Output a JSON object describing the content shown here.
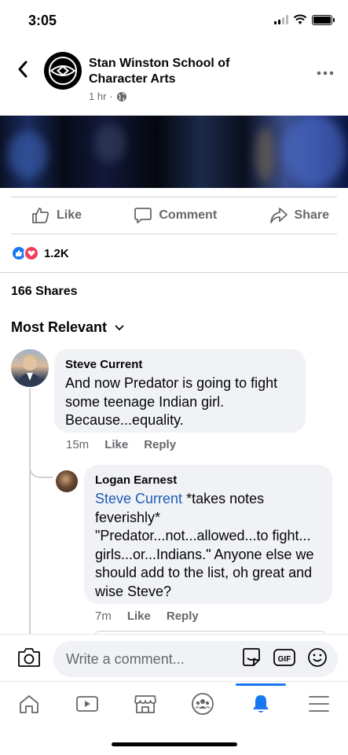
{
  "status_bar": {
    "time": "3:05",
    "icons": [
      "signal-icon",
      "wifi-icon",
      "battery-icon"
    ]
  },
  "header": {
    "page_name": "Stan Winston School of Character Arts",
    "time_ago": "1 hr",
    "separator": "·",
    "privacy_icon": "globe-icon"
  },
  "actions": {
    "like": "Like",
    "comment": "Comment",
    "share": "Share"
  },
  "reactions": {
    "count": "1.2K",
    "types": [
      "like",
      "love"
    ]
  },
  "shares": "166 Shares",
  "sort": {
    "label": "Most Relevant"
  },
  "comments": [
    {
      "author": "Steve Current",
      "text": "And now Predator is going to fight some teenage Indian girl. Because...equality.",
      "time": "15m",
      "like": "Like",
      "reply": "Reply"
    },
    {
      "author": "Logan Earnest",
      "mention": "Steve Current",
      "text": " *takes notes feverishly* \"Predator...not...allowed...to fight... girls...or...Indians.\" Anyone else we should add to the list, oh great and wise Steve?",
      "time": "7m",
      "like": "Like",
      "reply": "Reply"
    }
  ],
  "composer": {
    "placeholder": "Write a comment...",
    "gif_label": "GIF"
  },
  "bottom_nav": [
    "home",
    "watch",
    "marketplace",
    "groups",
    "notifications",
    "menu"
  ],
  "bottom_nav_active": "notifications",
  "colors": {
    "accent": "#1877f2",
    "mention": "#1d5bb8",
    "love": "#f33e58",
    "muted": "#65676b",
    "bubble": "#f0f2f5"
  }
}
